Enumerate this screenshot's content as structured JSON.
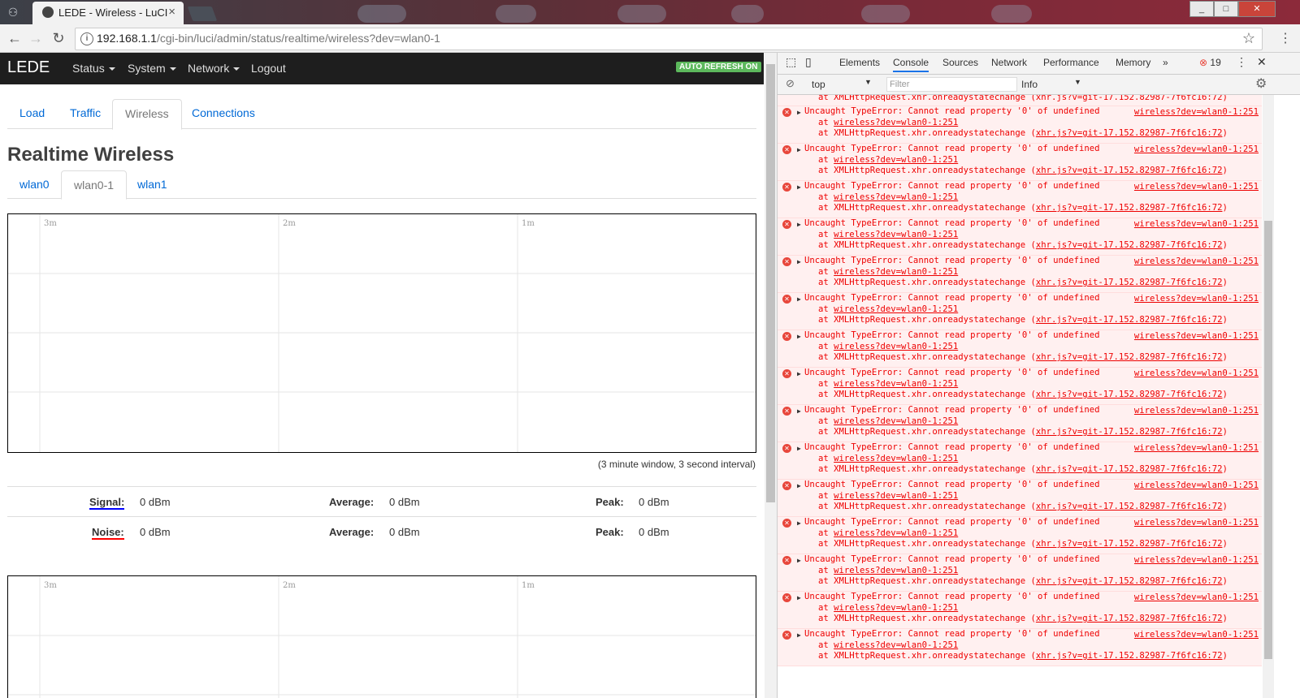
{
  "browser": {
    "tab_title": "LEDE - Wireless - LuCI",
    "tab_close": "×",
    "url_host": "192.168.1.1",
    "url_path": "/cgi-bin/luci/admin/status/realtime/wireless?dev=wlan0-1",
    "window_controls": [
      "_",
      "□",
      "✕"
    ]
  },
  "luci": {
    "brand": "LEDE",
    "menu": [
      "Status",
      "System",
      "Network",
      "Logout"
    ],
    "auto_refresh": "AUTO REFRESH ON",
    "tabs": [
      "Load",
      "Traffic",
      "Wireless",
      "Connections"
    ],
    "active_tab": "Wireless",
    "title": "Realtime Wireless",
    "subtabs": [
      "wlan0",
      "wlan0-1",
      "wlan1"
    ],
    "active_subtab": "wlan0-1",
    "graph_time_labels": [
      "3m",
      "2m",
      "1m"
    ],
    "graph_note": "(3 minute window, 3 second interval)",
    "signal": {
      "label": "Signal:",
      "value": "0 dBm",
      "avg_label": "Average:",
      "avg": "0 dBm",
      "peak_label": "Peak:",
      "peak": "0 dBm",
      "color": "#0000ff"
    },
    "noise": {
      "label": "Noise:",
      "value": "0 dBm",
      "avg_label": "Average:",
      "avg": "0 dBm",
      "peak_label": "Peak:",
      "peak": "0 dBm",
      "color": "#ff0000"
    }
  },
  "devtools": {
    "tabs": [
      "Elements",
      "Console",
      "Sources",
      "Network",
      "Performance",
      "Memory",
      "»"
    ],
    "active_tab": "Console",
    "error_count": "19",
    "context": "top",
    "filter_placeholder": "Filter",
    "level": "Info",
    "partial_line": "at XMLHttpRequest.xhr.onreadystatechange (xhr.js?v=git-17.152.82987-7f6fc16:72)",
    "error_message": "Uncaught TypeError: Cannot read property '0' of undefined",
    "error_source": "wireless?dev=wlan0-1:251",
    "stack_at_1_prefix": "at ",
    "stack_at_1": "wireless?dev=wlan0-1:251",
    "stack_at_2_prefix": "at XMLHttpRequest.xhr.onreadystatechange (",
    "stack_at_2": "xhr.js?v=git-17.152.82987-7f6fc16:72",
    "stack_at_2_suffix": ")",
    "error_repeat": 15,
    "prompt": "›"
  }
}
